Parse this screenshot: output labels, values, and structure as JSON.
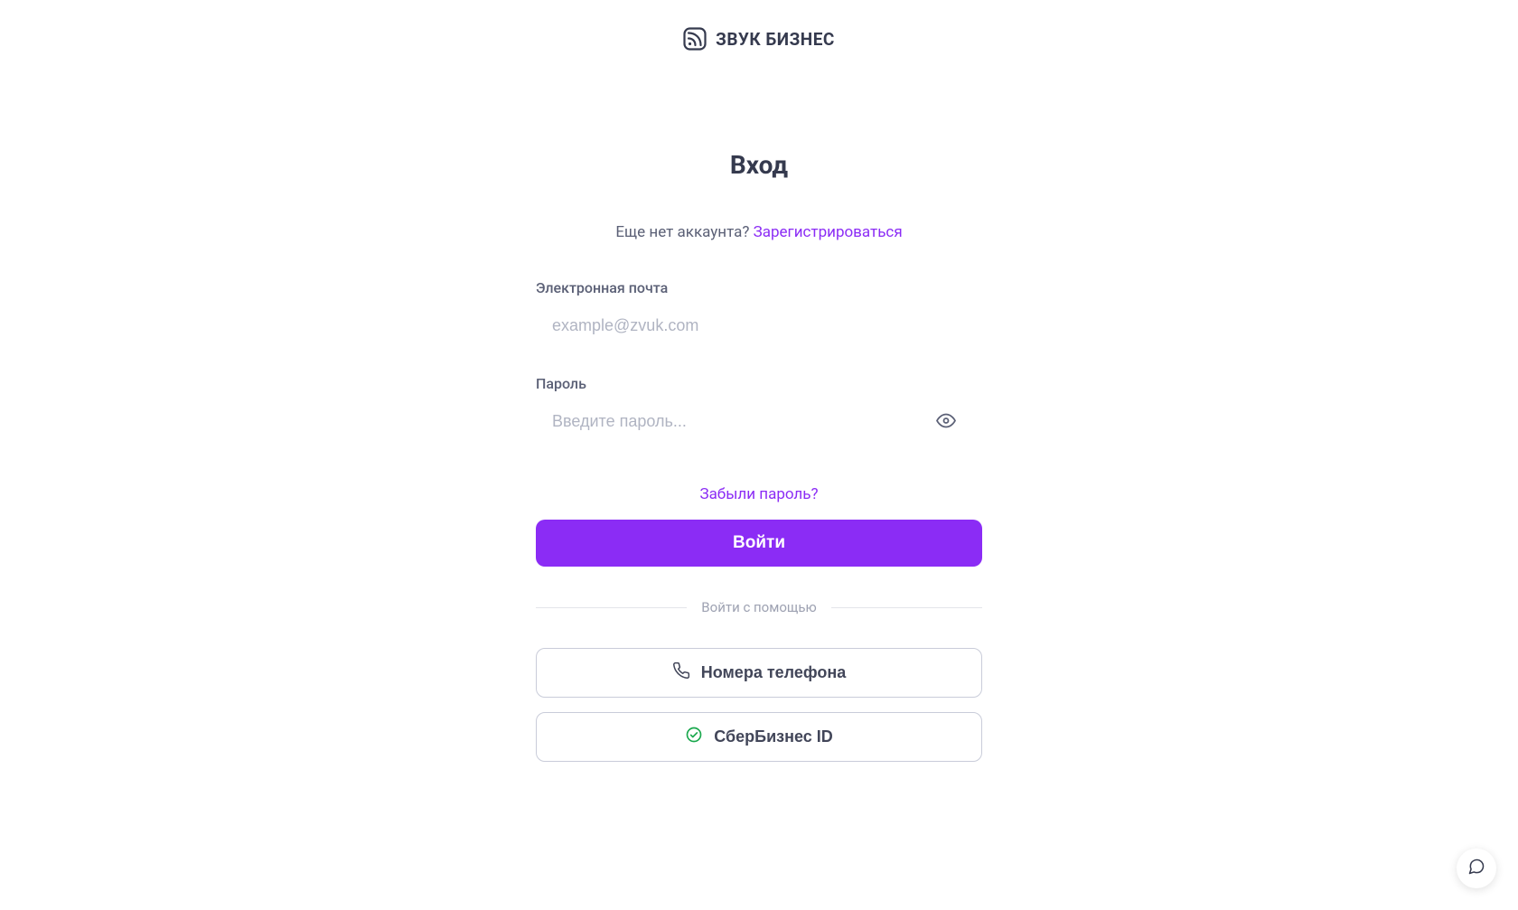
{
  "brand": {
    "name": "ЗВУК БИЗНЕС"
  },
  "page": {
    "title": "Вход",
    "no_account_text": "Еще нет аккаунта? ",
    "register_link": "Зарегистрироваться"
  },
  "fields": {
    "email": {
      "label": "Электронная почта",
      "placeholder": "example@zvuk.com",
      "value": ""
    },
    "password": {
      "label": "Пароль",
      "placeholder": "Введите пароль...",
      "value": ""
    }
  },
  "actions": {
    "forgot_password": "Забыли пароль?",
    "login": "Войти"
  },
  "divider": {
    "text": "Войти с помощью"
  },
  "alt_login": {
    "phone": "Номера телефона",
    "sber": "СберБизнес ID"
  },
  "colors": {
    "accent": "#8b2cf5",
    "text_primary": "#353a4e",
    "text_secondary": "#5b6076",
    "placeholder": "#b0b4c2",
    "border": "#c9ccd9"
  }
}
